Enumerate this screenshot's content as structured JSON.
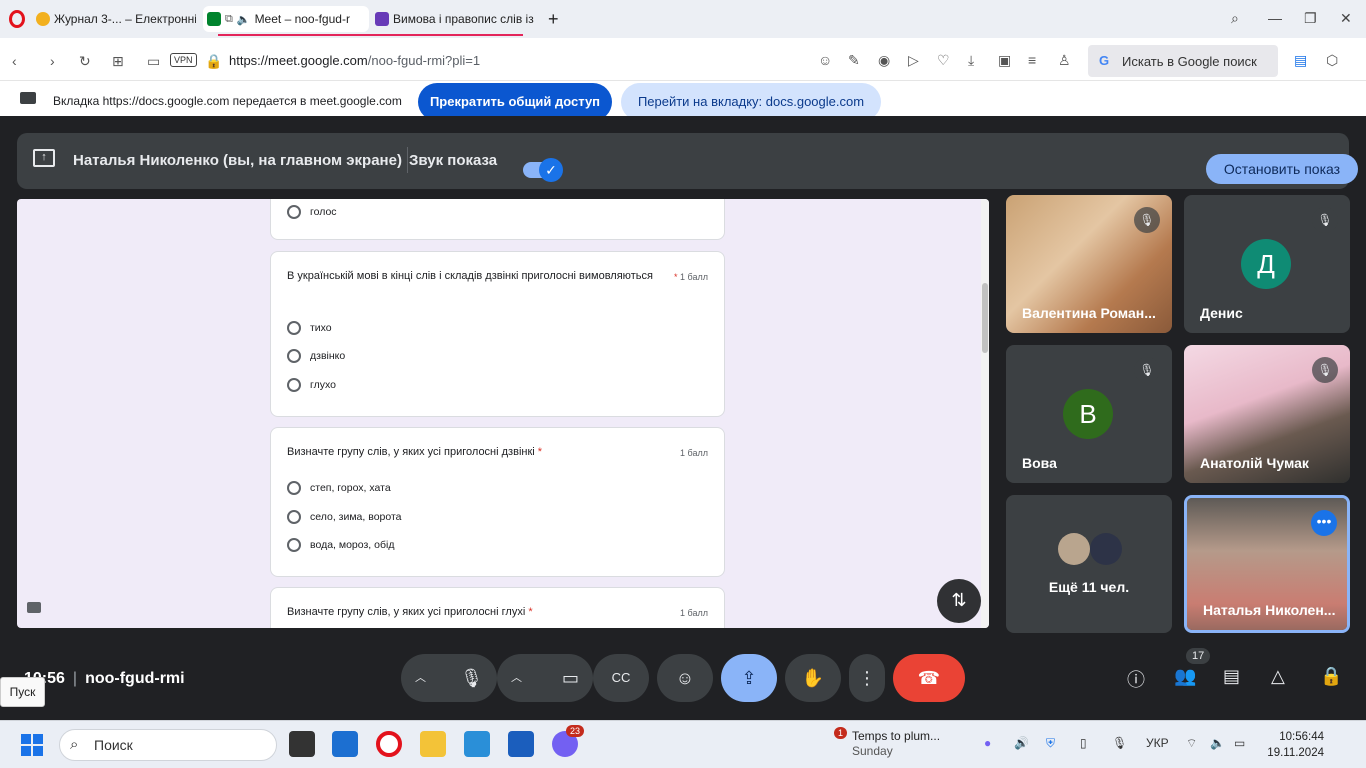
{
  "browser": {
    "tabs": [
      {
        "label": "Журнал 3-... – Електронні"
      },
      {
        "label": "Meet – noo-fgud-r"
      },
      {
        "label": "Вимова і правопис слів із"
      }
    ],
    "new_tab": "+",
    "url_prefix": "https://meet.google.com",
    "url_path": "/noo-fgud-rmi?pli=1",
    "vpn": "VPN",
    "search_box": "Искать в Google поиск",
    "share_message": "Вкладка https://docs.google.com передается в meet.google.com",
    "stop_share_button": "Прекратить общий доступ",
    "goto_tab_button": "Перейти на вкладку: docs.google.com"
  },
  "meet": {
    "banner_name": "Наталья Николенко (вы, на главном экране)",
    "sound_label": "Звук показа",
    "stop_present_button": "Остановить показ",
    "meeting_time": "10:56",
    "meeting_code": "noo-fgud-rmi",
    "participants_count": "17",
    "tiles": [
      {
        "name": "Валентина Роман..."
      },
      {
        "name": "Денис",
        "initial": "Д",
        "color": "#0f8b74"
      },
      {
        "name": "Вова",
        "initial": "В",
        "color": "#2f6b1c"
      },
      {
        "name": "Анатолій Чумак"
      },
      {
        "more_label": "Ещё 11 чел."
      },
      {
        "name": "Наталья Николен..."
      }
    ]
  },
  "form": {
    "top_option": "голос",
    "questions": [
      {
        "text": "В українській мові в кінці слів і складів дзвінкі приголосні вимовляються",
        "points": "1 балл",
        "options": [
          "тихо",
          "дзвінко",
          "глухо"
        ]
      },
      {
        "text": "Визначте групу слів, у яких усі приголосні дзвінкі",
        "points": "1 балл",
        "options": [
          "степ, горох, хата",
          "село, зима, ворота",
          "вода, мороз, обід"
        ]
      },
      {
        "text": "Визначте групу слів, у яких усі приголосні глухі",
        "points": "1 балл",
        "options": []
      }
    ],
    "required_mark": "*"
  },
  "tooltip": "Пуск",
  "taskbar": {
    "search": "Поиск",
    "viber_badge": "23",
    "weather_badge": "1",
    "weather_title": "Temps to plum...",
    "weather_sub": "Sunday",
    "lang": "УКР",
    "time": "10:56:44",
    "date": "19.11.2024"
  }
}
